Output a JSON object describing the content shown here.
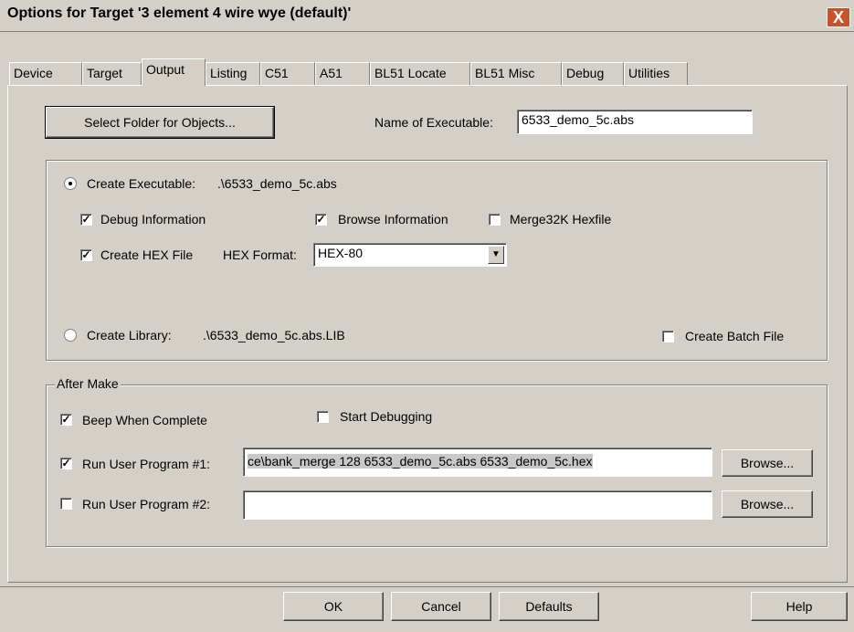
{
  "window": {
    "title": "Options for Target '3 element 4 wire wye (default)'",
    "close_label": "X"
  },
  "tabs": [
    {
      "label": "Device"
    },
    {
      "label": "Target"
    },
    {
      "label": "Output",
      "active": true
    },
    {
      "label": "Listing"
    },
    {
      "label": "C51"
    },
    {
      "label": "A51"
    },
    {
      "label": "BL51 Locate"
    },
    {
      "label": "BL51 Misc"
    },
    {
      "label": "Debug"
    },
    {
      "label": "Utilities"
    }
  ],
  "output": {
    "select_folder_label": "Select Folder for Objects...",
    "name_exec_label": "Name of Executable:",
    "name_exec_value": "6533_demo_5c.abs",
    "create_executable": {
      "label": "Create Executable:",
      "path": ".\\6533_demo_5c.abs",
      "selected": true
    },
    "debug_info": {
      "label": "Debug Information",
      "checked": true
    },
    "browse_info": {
      "label": "Browse Information",
      "checked": true
    },
    "merge32k": {
      "label": "Merge32K Hexfile",
      "checked": false
    },
    "create_hex": {
      "label": "Create HEX File",
      "checked": true
    },
    "hex_format_label": "HEX Format:",
    "hex_format_value": "HEX-80",
    "create_library": {
      "label": "Create Library:",
      "path": ".\\6533_demo_5c.abs.LIB",
      "selected": false
    },
    "create_batch": {
      "label": "Create Batch File",
      "checked": false
    }
  },
  "after_make": {
    "label": "After Make",
    "beep": {
      "label": "Beep When Complete",
      "checked": true
    },
    "start_debug": {
      "label": "Start Debugging",
      "checked": false
    },
    "run1": {
      "label": "Run User Program #1:",
      "checked": true,
      "value": "ce\\bank_merge 128 6533_demo_5c.abs 6533_demo_5c.hex",
      "browse": "Browse..."
    },
    "run2": {
      "label": "Run User Program #2:",
      "checked": false,
      "value": "",
      "browse": "Browse..."
    }
  },
  "footer": {
    "ok": "OK",
    "cancel": "Cancel",
    "defaults": "Defaults",
    "help": "Help"
  }
}
